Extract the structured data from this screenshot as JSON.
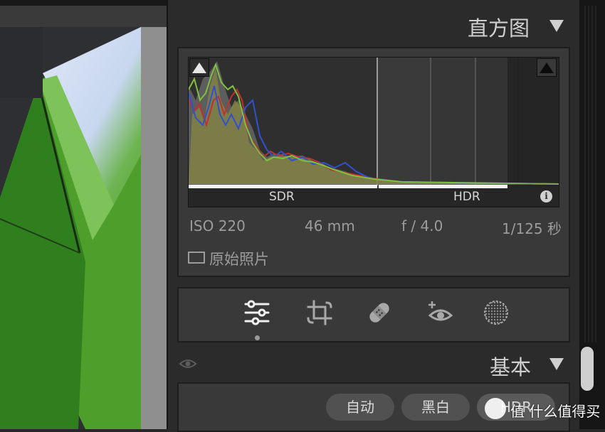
{
  "histogram": {
    "title": "直方图",
    "sdr_label": "SDR",
    "hdr_label": "HDR",
    "info_icon": "info-icon",
    "clip_shadow_icon": "shadow-clipping-triangle-icon",
    "clip_highlight_icon": "highlight-clipping-triangle-icon"
  },
  "exif": {
    "iso": "ISO 220",
    "focal_length": "46 mm",
    "aperture": "f / 4.0",
    "shutter": "1/125 秒"
  },
  "original_photo": {
    "label": "原始照片",
    "checked": false
  },
  "tools": [
    {
      "icon": "edit-sliders-icon",
      "active": true
    },
    {
      "icon": "crop-rotate-icon",
      "active": false
    },
    {
      "icon": "healing-bandage-icon",
      "active": false
    },
    {
      "icon": "red-eye-icon",
      "active": false
    },
    {
      "icon": "masking-circle-icon",
      "active": false
    }
  ],
  "basic": {
    "title": "基本",
    "buttons": [
      "自动",
      "黑白"
    ],
    "hdr_button": "HDR"
  },
  "watermark": {
    "text": "值 什么值得买"
  },
  "colors": {
    "panel_bg": "#2b2b2b",
    "box_bg": "#393939",
    "histogram_red": "#c03030",
    "histogram_green": "#7fc040",
    "histogram_blue": "#3050d0",
    "histogram_yellow": "#b8b040",
    "histogram_gray": "#8a8a8a",
    "photo_green": "#4e9e2c"
  }
}
